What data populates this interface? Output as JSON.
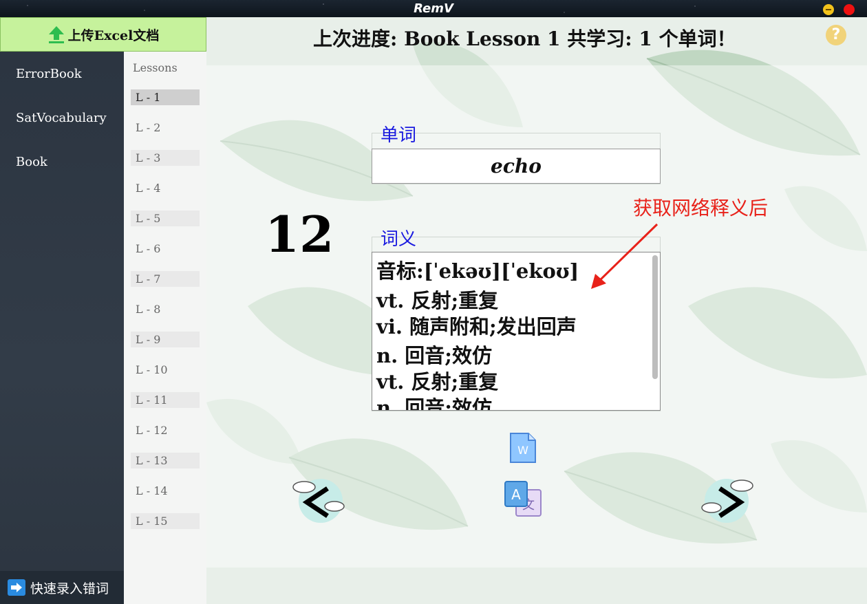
{
  "window": {
    "title": "RemV"
  },
  "sidebar": {
    "upload_label": "上传Excel文档",
    "items": [
      {
        "label": "ErrorBook"
      },
      {
        "label": "SatVocabulary"
      },
      {
        "label": "Book"
      }
    ],
    "quick_entry_label": "快速录入错词"
  },
  "lessons": {
    "title": "Lessons",
    "items": [
      "L - 1",
      "L - 2",
      "L - 3",
      "L - 4",
      "L - 5",
      "L - 6",
      "L - 7",
      "L - 8",
      "L - 9",
      "L - 10",
      "L - 11",
      "L - 12",
      "L - 13",
      "L - 14",
      "L - 15"
    ],
    "selected": "L - 1"
  },
  "header": {
    "progress": "上次进度: Book Lesson 1  共学习: 1 个单词！"
  },
  "word_section": {
    "label": "单词",
    "value": "echo"
  },
  "count": "12",
  "definition_section": {
    "label": "词义",
    "lines": [
      "音标:[ˈekəʊ][ˈekoʊ]",
      "vt. 反射;重复",
      "vi. 随声附和;发出回声",
      "n. 回音;效仿",
      "vt. 反射;重复",
      "n. 回音;效仿"
    ]
  },
  "annotation": "获取网络释义后",
  "icons": {
    "help": "help-icon",
    "word_doc": "word-document-icon",
    "translate": "translate-icon",
    "prev": "previous-cloud-icon",
    "next": "next-cloud-icon",
    "upload": "upload-arrow-icon",
    "quick_entry": "quick-entry-icon"
  },
  "colors": {
    "upload_bg": "#c6f29c",
    "label_blue": "#1a1ae0",
    "annotation_red": "#e8221a"
  }
}
